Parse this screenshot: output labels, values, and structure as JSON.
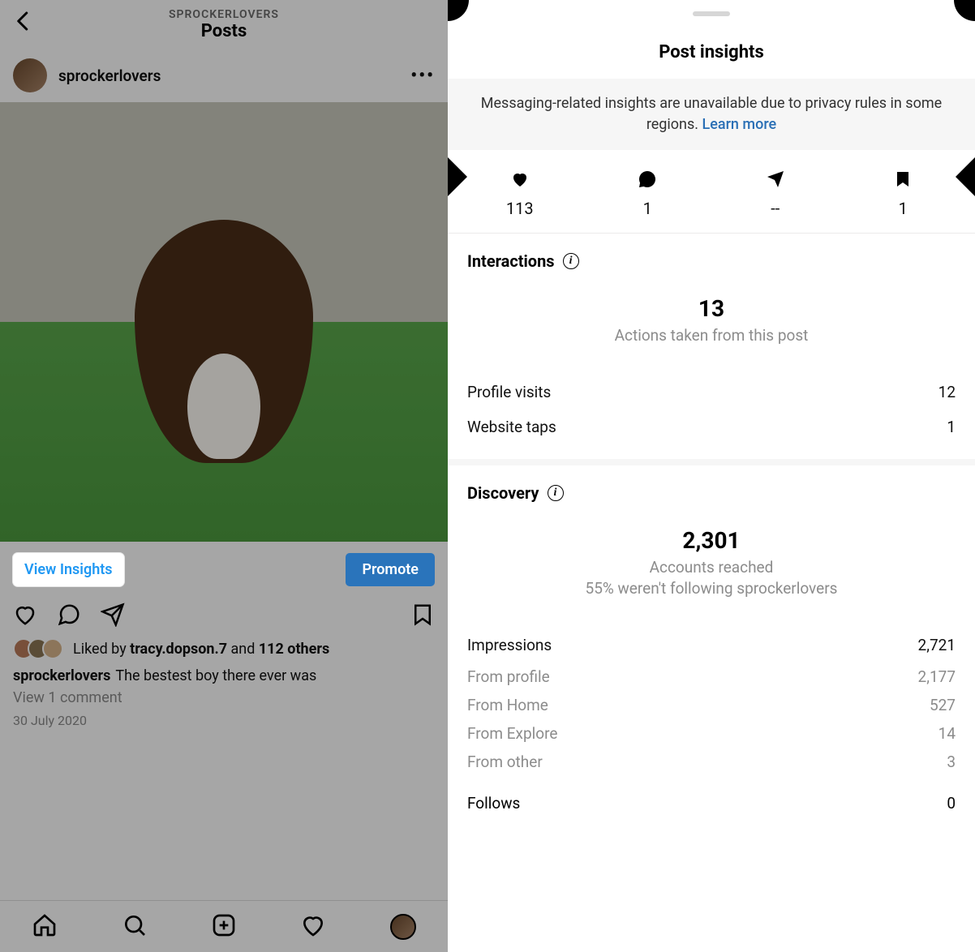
{
  "left": {
    "header_sub": "SPROCKERLOVERS",
    "header_title": "Posts",
    "username": "sprockerlovers",
    "view_insights": "View Insights",
    "promote": "Promote",
    "liked_prefix": "Liked by ",
    "liked_user": "tracy.dopson.7",
    "liked_mid": " and ",
    "liked_others": "112 others",
    "caption_user": "sprockerlovers",
    "caption_text": "The bestest boy there ever was",
    "view_comment": "View 1 comment",
    "post_date": "30 July 2020"
  },
  "right": {
    "title": "Post insights",
    "banner_text": "Messaging-related insights are unavailable due to privacy rules in some regions. ",
    "banner_link": "Learn more",
    "stats": {
      "likes": "113",
      "comments": "1",
      "shares": "--",
      "saves": "1"
    },
    "interactions": {
      "heading": "Interactions",
      "big": "13",
      "big_sub": "Actions taken from this post",
      "rows": [
        {
          "label": "Profile visits",
          "value": "12"
        },
        {
          "label": "Website taps",
          "value": "1"
        }
      ]
    },
    "discovery": {
      "heading": "Discovery",
      "big": "2,301",
      "sub1": "Accounts reached",
      "sub2": "55% weren't following sprockerlovers",
      "impressions_label": "Impressions",
      "impressions_value": "2,721",
      "breakdown": [
        {
          "label": "From profile",
          "value": "2,177"
        },
        {
          "label": "From Home",
          "value": "527"
        },
        {
          "label": "From Explore",
          "value": "14"
        },
        {
          "label": "From other",
          "value": "3"
        }
      ],
      "follows_label": "Follows",
      "follows_value": "0"
    }
  }
}
